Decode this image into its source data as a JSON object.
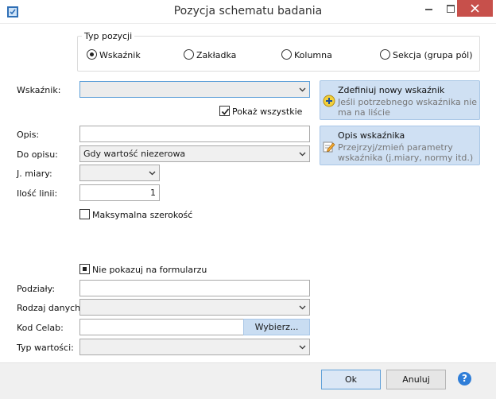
{
  "window": {
    "title": "Pozycja schematu badania"
  },
  "typ_pozycji": {
    "title": "Typ pozycji",
    "options": [
      "Wskaźnik",
      "Zakładka",
      "Kolumna",
      "Sekcja (grupa pól)"
    ],
    "selected": "Wskaźnik"
  },
  "form": {
    "wskaznik_label": "Wskaźnik:",
    "wskaznik_value": "",
    "pokaz_wszystkie_label": "Pokaż wszystkie",
    "opis_label": "Opis:",
    "opis_value": "",
    "do_opisu_label": "Do opisu:",
    "do_opisu_value": "Gdy wartość niezerowa",
    "jmiary_label": "J. miary:",
    "jmiary_value": "",
    "ilosc_linii_label": "Ilość linii:",
    "ilosc_linii_value": "1",
    "max_szer_label": "Maksymalna szerokość",
    "nie_pokazuj_label": "Nie pokazuj na formularzu",
    "podzialy_label": "Podziały:",
    "podzialy_value": "",
    "rodzaj_danych_label": "Rodzaj danych:",
    "rodzaj_danych_value": "",
    "kod_celab_label": "Kod Celab:",
    "kod_celab_value": "",
    "wybierz_label": "Wybierz...",
    "typ_wartosci_label": "Typ wartości:",
    "typ_wartosci_value": ""
  },
  "cards": {
    "zdefiniuj_title": "Zdefiniuj nowy wskaźnik",
    "zdefiniuj_desc": "Jeśli potrzebnego wskaźnika nie ma na liście",
    "opis_title": "Opis wskaźnika",
    "opis_desc": "Przejrzyj/zmień parametry wskaźnika (j.miary, normy itd.)"
  },
  "footer": {
    "ok_label": "Ok",
    "cancel_label": "Anuluj",
    "help_label": "?"
  },
  "colors": {
    "accent": "#2f7ed8",
    "close_button": "#c7504b",
    "card_bg": "#cfe0f3"
  },
  "icons": [
    "app-icon",
    "minimize-icon",
    "maximize-icon",
    "close-icon",
    "plus-icon",
    "edit-icon",
    "chevron-down-icon",
    "help-icon"
  ]
}
